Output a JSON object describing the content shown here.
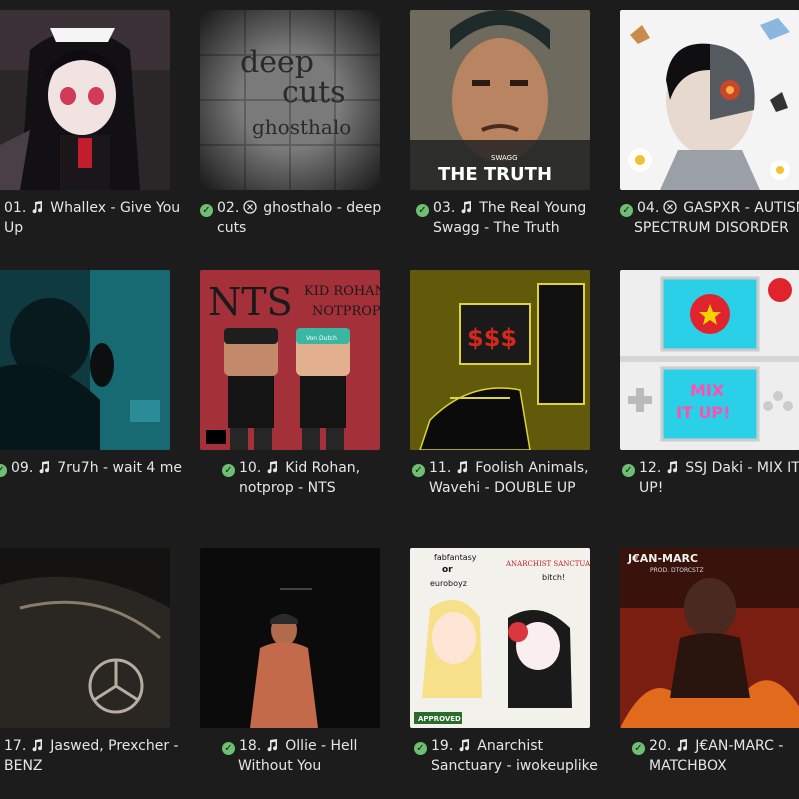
{
  "colors": {
    "background": "#1c1c1c",
    "text": "#e6e6e6",
    "check": "#6fbf73"
  },
  "art_text": {
    "t2": [
      "deep",
      "cuts",
      "ghosthalo"
    ],
    "t3": [
      "SWAGG",
      "THE TRUTH"
    ],
    "t6": [
      "NTS",
      "KID ROHAN",
      "NOTPROP",
      "Von Dutch"
    ],
    "t7": [
      "$$$"
    ],
    "t8": [
      "MIX",
      "IT UP!"
    ],
    "t11": [
      "fabfantasy",
      "or",
      "euroboyz",
      "ANARCHIST SANCTUARY",
      "bitch!",
      "APPROVED"
    ],
    "t12": [
      "J€AN-MARC",
      "PROD. DTORCSTZ"
    ]
  },
  "tracks": [
    {
      "number": "01.",
      "type_icon": "music-note-icon",
      "line1": "Whallex - Give You",
      "line2": "Up",
      "checked": false
    },
    {
      "number": "02.",
      "type_icon": "album-disc-icon",
      "line1": "ghosthalo - deep",
      "line2": "cuts",
      "checked": true
    },
    {
      "number": "03.",
      "type_icon": "music-note-icon",
      "line1": "The Real Young",
      "line2": "Swagg - The Truth",
      "checked": true
    },
    {
      "number": "04.",
      "type_icon": "album-disc-icon",
      "line1": "GASPXR - AUTISM",
      "line2": "SPECTRUM DISORDER",
      "checked": true
    },
    {
      "number": "09.",
      "type_icon": "music-note-icon",
      "line1": "7ru7h - wait 4 me",
      "line2": "",
      "checked": true
    },
    {
      "number": "10.",
      "type_icon": "music-note-icon",
      "line1": "Kid Rohan,",
      "line2": "notprop - NTS",
      "checked": true
    },
    {
      "number": "11.",
      "type_icon": "music-note-icon",
      "line1": "Foolish Animals,",
      "line2": "Wavehi - DOUBLE UP",
      "checked": true
    },
    {
      "number": "12.",
      "type_icon": "music-note-icon",
      "line1": "SSJ Daki - MIX IT",
      "line2": "UP!",
      "checked": true
    },
    {
      "number": "17.",
      "type_icon": "music-note-icon",
      "line1": "Jaswed, Prexcher -",
      "line2": "BENZ",
      "checked": false
    },
    {
      "number": "18.",
      "type_icon": "music-note-icon",
      "line1": "Ollie - Hell",
      "line2": "Without You",
      "checked": true
    },
    {
      "number": "19.",
      "type_icon": "music-note-icon",
      "line1": "Anarchist",
      "line2": "Sanctuary - iwokeuplike",
      "checked": true
    },
    {
      "number": "20.",
      "type_icon": "music-note-icon",
      "line1": "J€AN-MARC -",
      "line2": "MATCHBOX",
      "checked": true
    }
  ]
}
